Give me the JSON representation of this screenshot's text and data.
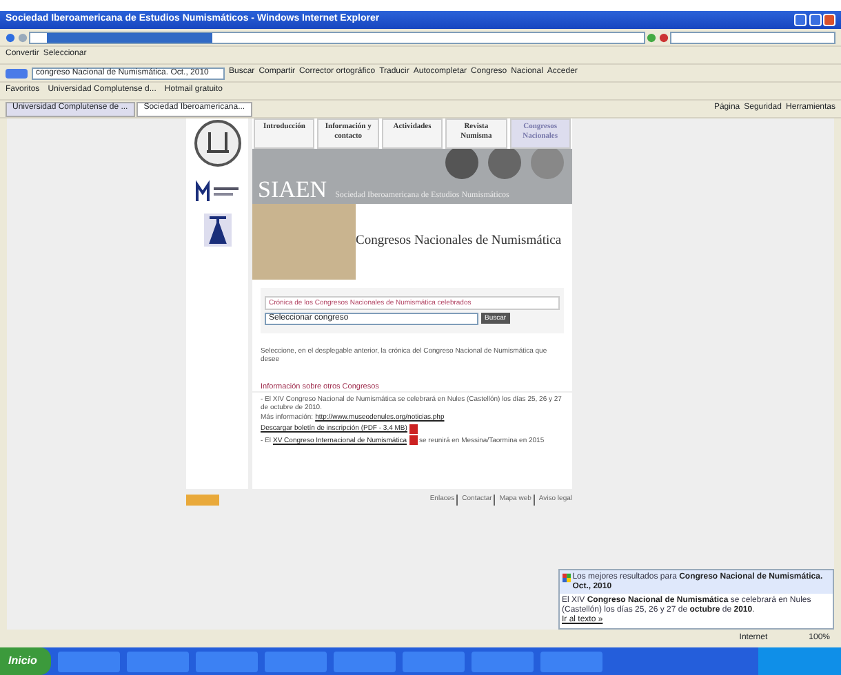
{
  "window": {
    "title": "Sociedad Iberoamericana de Estudios Numismáticos - Windows Internet Explorer"
  },
  "command_bar": {
    "items": [
      "Convertir",
      "Seleccionar"
    ]
  },
  "google_toolbar": {
    "search": "congreso Nacional de Numismática. Oct., 2010",
    "buttons": [
      "Buscar",
      "Compartir",
      "Corrector ortográfico",
      "Traducir",
      "Autocompletar",
      "Congreso",
      "Nacional",
      "Acceder"
    ]
  },
  "favorites_bar": {
    "items": [
      "Favoritos",
      "Universidad Complutense d...",
      "Hotmail gratuito"
    ]
  },
  "tabs": [
    {
      "label": "Universidad Complutense de ...",
      "selected": false
    },
    {
      "label": "Sociedad Iberoamericana...",
      "selected": true
    }
  ],
  "tab_tools": [
    "Página",
    "Seguridad",
    "Herramientas"
  ],
  "site": {
    "nav": [
      {
        "label": "Introducción",
        "selected": false
      },
      {
        "label": "Información y contacto",
        "selected": false
      },
      {
        "label": "Actividades",
        "selected": false
      },
      {
        "label": "Revista Numisma",
        "selected": false
      },
      {
        "label": "Congresos Nacionales",
        "selected": true
      }
    ],
    "banner": {
      "acronym": "SIAEN",
      "name": "Sociedad Iberoamericana de Estudios Numismáticos"
    },
    "heading": "Congresos Nacionales de Numismática",
    "selector": {
      "legend": "Crónica de los Congresos Nacionales de Numismática celebrados",
      "select": "Seleccionar congreso",
      "button": "Buscar",
      "hint": "Seleccione, en el desplegable anterior, la crónica del Congreso Nacional de Numismática que desee"
    },
    "info": {
      "title": "Información sobre otros Congresos",
      "news": "- El XIV Congreso Nacional de Numismática se celebrará en Nules (Castellón) los días 25, 26 y 27 de octubre de 2010.",
      "more_label": "Más información:",
      "more_link": "http://www.museodenules.org/noticias.php",
      "download": "Descargar boletín de inscripción (PDF - 3,4 MB)",
      "congress_prefix": "- El",
      "congress_link": "XV Congreso Internacional de Numismática",
      "congress_suffix": "se reunirá en Messina/Taormina en 2015"
    },
    "footer_links": [
      "Enlaces",
      "Contactar",
      "Mapa web",
      "Aviso legal"
    ]
  },
  "popup": {
    "title": "Los mejores resultados para **Congreso Nacional de Numismática. Oct., 2010**",
    "body": "El XIV **Congreso Nacional de Numismática** se celebrará en Nules (Castellón) los días 25, 26 y 27 de **octubre** de **2010**.",
    "link": "Ir al texto »"
  },
  "status_bar": {
    "zone": "Internet",
    "zoom": "100%"
  },
  "taskbar": {
    "start": "Inicio"
  }
}
